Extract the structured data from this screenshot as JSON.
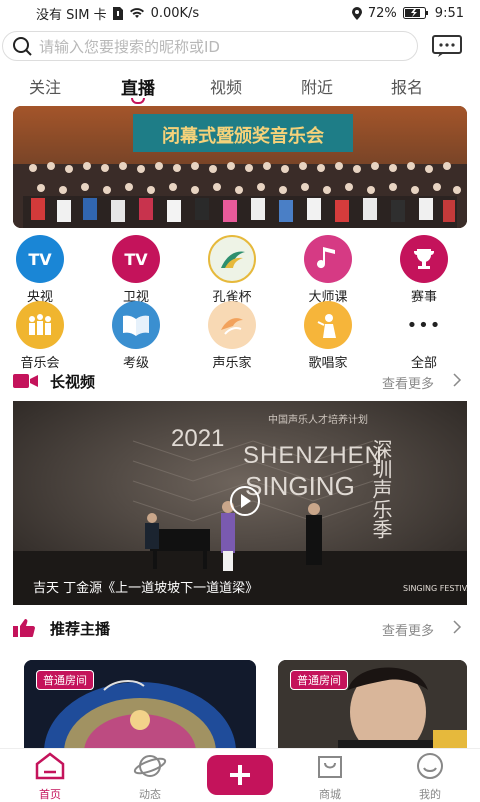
{
  "status": {
    "carrier": "没有 SIM 卡",
    "speed": "0.00K/s",
    "battery": "72%",
    "time": "9:51"
  },
  "search": {
    "placeholder": "请输入您要搜索的昵称或ID"
  },
  "tabs": [
    {
      "label": "关注"
    },
    {
      "label": "直播"
    },
    {
      "label": "视频"
    },
    {
      "label": "附近"
    },
    {
      "label": "报名"
    }
  ],
  "banner": {
    "caption": "闭幕式暨颁奖音乐会"
  },
  "categories": [
    {
      "label": "央视",
      "icon_text": "TV",
      "color": "#1a86d6",
      "icon": "tv-icon"
    },
    {
      "label": "卫视",
      "icon_text": "TV",
      "color": "#c4135b",
      "icon": "tv-icon"
    },
    {
      "label": "孔雀杯",
      "icon_text": "",
      "color": "#6aa36a",
      "icon": "peacock-icon"
    },
    {
      "label": "大师课",
      "icon_text": "",
      "color": "#d63a84",
      "icon": "music-note-icon"
    },
    {
      "label": "赛事",
      "icon_text": "",
      "color": "#c4135b",
      "icon": "trophy-icon"
    },
    {
      "label": "音乐会",
      "icon_text": "",
      "color": "#f0b52f",
      "icon": "concert-icon"
    },
    {
      "label": "考级",
      "icon_text": "",
      "color": "#3a8fd0",
      "icon": "book-icon"
    },
    {
      "label": "声乐家",
      "icon_text": "",
      "color": "#f2a25c",
      "icon": "vocalist-icon"
    },
    {
      "label": "歌唱家",
      "icon_text": "",
      "color": "#f6b53a",
      "icon": "singer-icon"
    },
    {
      "label": "全部",
      "icon_text": "•••",
      "color": "#ffffff",
      "icon": "more-dots-icon"
    }
  ],
  "long_video": {
    "title": "长视频",
    "more": "查看更多",
    "video_caption": "吉天 丁金源《上一道坡坡下一道道梁》",
    "poster": {
      "year": "2021",
      "line1": "SHENZHEN",
      "line2": "SINGING",
      "cn_vertical": "深圳声乐季",
      "top_text": "中国声乐人才培养计划",
      "logo_text": "SINGING FESTIVAL"
    }
  },
  "recommend": {
    "title": "推荐主播",
    "more": "查看更多",
    "cards": [
      {
        "badge": "普通房间"
      },
      {
        "badge": "普通房间"
      }
    ]
  },
  "bottom_nav": [
    {
      "label": "首页",
      "icon": "home-icon",
      "active": true
    },
    {
      "label": "动态",
      "icon": "planet-icon",
      "active": false
    },
    {
      "label": "",
      "icon": "plus-icon",
      "active": false
    },
    {
      "label": "商城",
      "icon": "shop-bag-icon",
      "active": false
    },
    {
      "label": "我的",
      "icon": "profile-face-icon",
      "active": false
    }
  ],
  "colors": {
    "accent": "#c4135b",
    "muted": "#8a8a8a"
  }
}
